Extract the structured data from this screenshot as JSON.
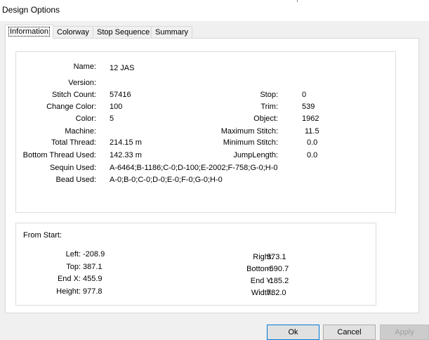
{
  "window": {
    "title": "Design Options"
  },
  "tabs": [
    {
      "label": "Information",
      "active": true
    },
    {
      "label": "Colorway"
    },
    {
      "label": "Stop Sequence"
    },
    {
      "label": "Summary"
    }
  ],
  "info": {
    "name_label": "Name:",
    "name": "12 JAS",
    "version_label": "Version:",
    "version": "",
    "stitch_count_label": "Stitch Count:",
    "stitch_count": "57416",
    "change_color_label": "Change Color:",
    "change_color": "100",
    "color_label": "Color:",
    "color": "5",
    "machine_label": "Machine:",
    "machine": "",
    "total_thread_label": "Total Thread:",
    "total_thread": "214.15 m",
    "bottom_thread_label": "Bottom Thread Used:",
    "bottom_thread": "142.33 m",
    "sequin_label": "Sequin Used:",
    "sequin": "A-6464;B-1186;C-0;D-100;E-2002;F-758;G-0;H-0",
    "bead_label": "Bead Used:",
    "bead": "A-0;B-0;C-0;D-0;E-0;F-0;G-0;H-0",
    "stop_label": "Stop:",
    "stop": "0",
    "trim_label": "Trim:",
    "trim": "539",
    "object_label": "Object:",
    "object": "1962",
    "max_stitch_label": "Maximum Stitch:",
    "max_stitch": "11.5",
    "min_stitch_label": "Minimum Stitch:",
    "min_stitch": "0.0",
    "jump_label": "JumpLength:",
    "jump": "0.0"
  },
  "from_start": {
    "heading": "From Start:",
    "left_label": "Left:",
    "left": "-208.9",
    "top_label": "Top:",
    "top": "387.1",
    "endx_label": "End X:",
    "endx": "455.9",
    "height_label": "Height:",
    "height": "977.8",
    "right_label": "Right:",
    "right": "573.1",
    "bottom_label": "Bottom:",
    "bottom": "-590.7",
    "endy_label": "End Y:",
    "endy": "-185.2",
    "width_label": "Width:",
    "width": "782.0"
  },
  "buttons": {
    "ok": "Ok",
    "cancel": "Cancel",
    "apply": "Apply"
  }
}
